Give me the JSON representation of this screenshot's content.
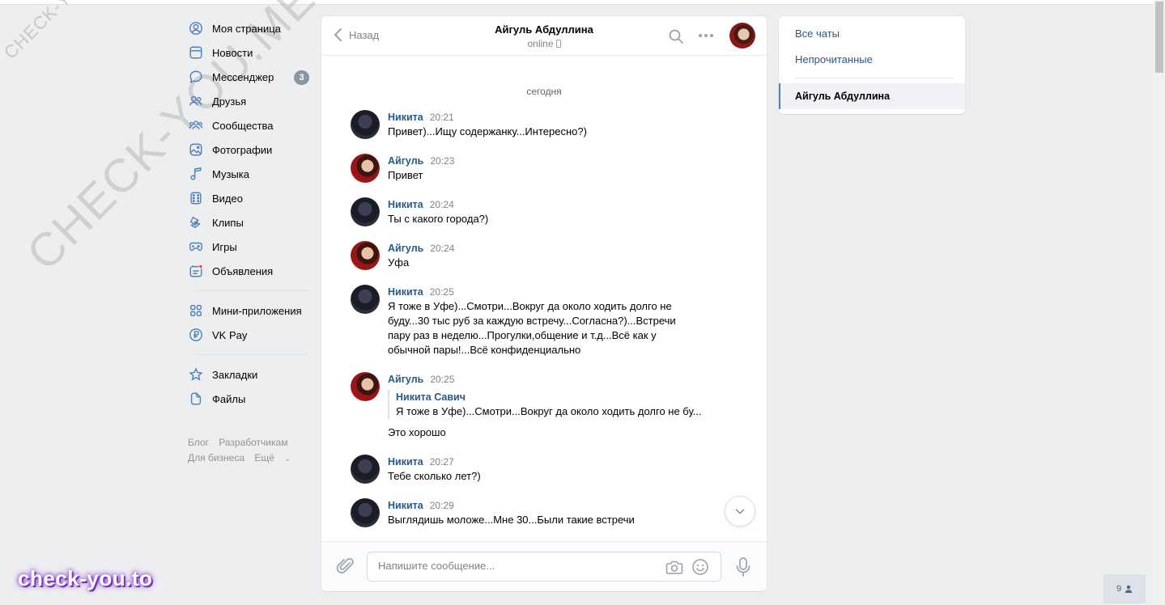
{
  "watermark": {
    "small": "CHECK-YOU.ME",
    "big": "CHECK-YOU.ME",
    "brand": "check-you.to"
  },
  "left_menu": {
    "items": [
      {
        "label": "Моя страница",
        "icon": "user-circle-icon"
      },
      {
        "label": "Новости",
        "icon": "news-icon"
      },
      {
        "label": "Мессенджер",
        "icon": "message-icon",
        "badge": "3"
      },
      {
        "label": "Друзья",
        "icon": "friends-icon"
      },
      {
        "label": "Сообщества",
        "icon": "communities-icon"
      },
      {
        "label": "Фотографии",
        "icon": "photo-icon"
      },
      {
        "label": "Музыка",
        "icon": "music-icon"
      },
      {
        "label": "Видео",
        "icon": "video-icon"
      },
      {
        "label": "Клипы",
        "icon": "clips-icon"
      },
      {
        "label": "Игры",
        "icon": "gamepad-icon"
      },
      {
        "label": "Объявления",
        "icon": "ads-icon"
      }
    ],
    "items2": [
      {
        "label": "Мини-приложения",
        "icon": "apps-icon"
      },
      {
        "label": "VK Pay",
        "icon": "vkpay-icon"
      }
    ],
    "items3": [
      {
        "label": "Закладки",
        "icon": "star-icon"
      },
      {
        "label": "Файлы",
        "icon": "file-icon"
      }
    ],
    "footer": [
      "Блог",
      "Разработчикам",
      "Для бизнеса",
      "Ещё"
    ]
  },
  "chat": {
    "back_label": "Назад",
    "title": "Айгуль Абдуллина",
    "status": "online",
    "day_label": "сегодня",
    "messages": [
      {
        "name": "Никита",
        "time": "20:21",
        "text": "Привет)...Ищу содержанку...Интересно?)"
      },
      {
        "name": "Айгуль",
        "time": "20:23",
        "text": "Привет"
      },
      {
        "name": "Никита",
        "time": "20:24",
        "text": "Ты с какого города?)"
      },
      {
        "name": "Айгуль",
        "time": "20:24",
        "text": "Уфа"
      },
      {
        "name": "Никита",
        "time": "20:25",
        "text": "Я тоже в Уфе)...Смотри...Вокруг да около ходить долго не буду...30 тыс руб за каждую встречу...Согласна?)...Встречи пару раз в неделю...Прогулки,общение и т.д...Всё как у обычной пары!...Всё конфиденциально"
      },
      {
        "name": "Айгуль",
        "time": "20:25",
        "quote_name": "Никита Савич",
        "quote_text": "Я тоже в Уфе)...Смотри...Вокруг да около ходить долго не бу...",
        "text": "Это хорошо"
      },
      {
        "name": "Никита",
        "time": "20:27",
        "text": "Тебе сколько лет?)"
      },
      {
        "name": "Никита",
        "time": "20:29",
        "text": "Выглядишь моложе...Мне 30...Были такие встречи"
      }
    ],
    "input_placeholder": "Напишите сообщение..."
  },
  "right_panel": {
    "all_chats": "Все чаты",
    "unread": "Непрочитанные",
    "active_chat": "Айгуль Абдуллина"
  },
  "online_counter": "9",
  "colors": {
    "background": "#edeef0",
    "link": "#2a5885",
    "badge": "#8a96a3",
    "accent": "#5181b8",
    "brand_glow": "#8b3fd1"
  }
}
